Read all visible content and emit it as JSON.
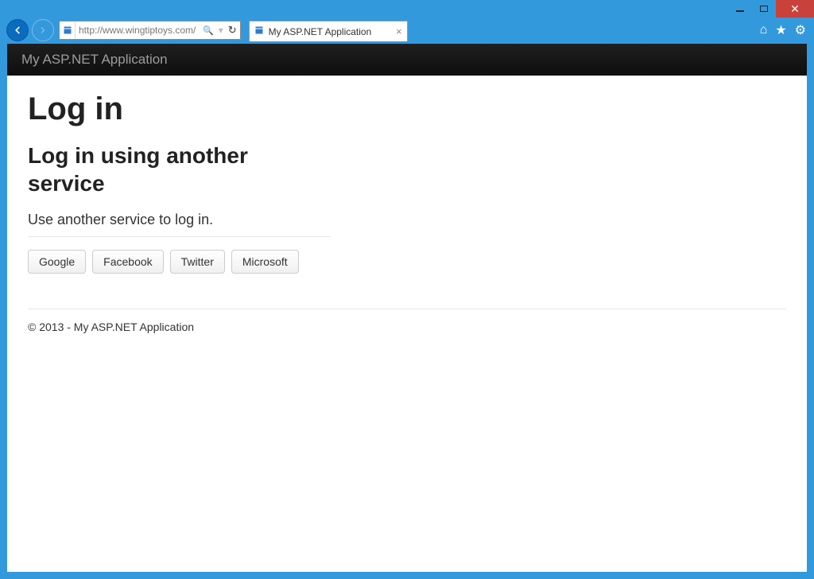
{
  "window": {
    "close_label": "✕"
  },
  "browser": {
    "url": "http://www.wingtiptoys.com/",
    "search_glyph": "🔍",
    "refresh_glyph": "↻",
    "tab_title": "My ASP.NET Application",
    "icons": {
      "home": "⌂",
      "star": "★",
      "gear": "⚙"
    }
  },
  "navbar": {
    "brand": "My ASP.NET Application"
  },
  "page": {
    "h1": "Log in",
    "h2": "Log in using another service",
    "sub": "Use another service to log in.",
    "providers": [
      "Google",
      "Facebook",
      "Twitter",
      "Microsoft"
    ]
  },
  "footer": {
    "text": "© 2013 - My ASP.NET Application"
  }
}
